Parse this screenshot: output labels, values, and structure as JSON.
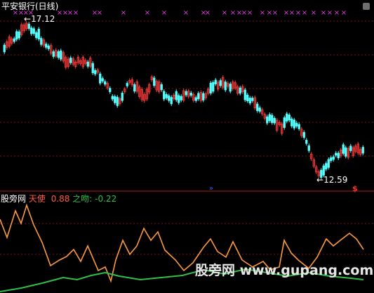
{
  "window": {
    "title": "平安银行(日线)",
    "background": "#000000"
  },
  "price_panel": {
    "high_label": "17.12",
    "low_label": "12.59",
    "high_value": 17.12,
    "low_value": 12.59,
    "signal_marker": "×",
    "signal_color": "#e040e0",
    "up_color": "#ff3b3b",
    "down_color": "#54ffff",
    "grid_color": "#7a1010",
    "bottom_marker": "$",
    "bottom_marker_color": "#ff3030",
    "arrow_icon": "double-arrow-icon"
  },
  "indicator_panel": {
    "name": "股旁网",
    "series_a_label": "天使",
    "series_a_value": "0.88",
    "series_a_color": "#ff9a40",
    "series_b_label": "之吻",
    "series_b_value": "-0.22",
    "series_b_color": "#2fbf4b"
  },
  "watermark": "股旁网 www.gupang.com"
}
